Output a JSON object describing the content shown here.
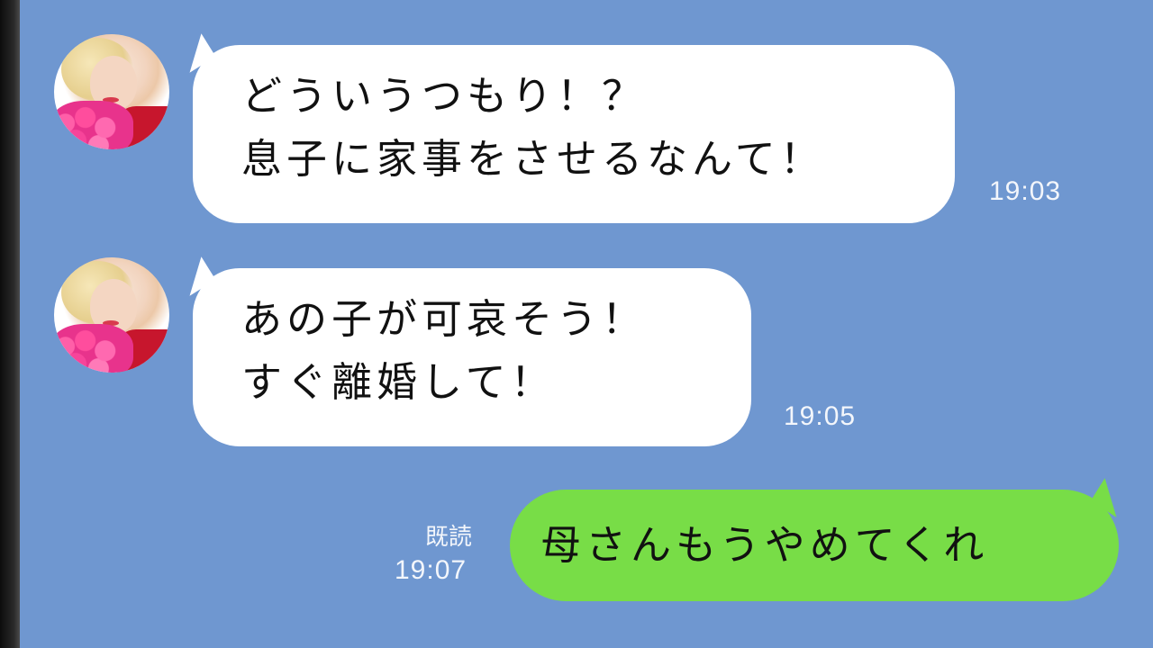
{
  "chat": {
    "messages": [
      {
        "sender": "other",
        "lines": [
          "どういうつもり！？",
          "息子に家事をさせるなんて！"
        ],
        "time": "19:03"
      },
      {
        "sender": "other",
        "lines": [
          "あの子が可哀そう！",
          "すぐ離婚して！"
        ],
        "time": "19:05"
      },
      {
        "sender": "me",
        "text": "母さんもうやめてくれ",
        "read_label": "既読",
        "time": "19:07"
      }
    ]
  },
  "colors": {
    "background": "#6F97D0",
    "incoming_bubble": "#FFFFFF",
    "outgoing_bubble": "#78DD47",
    "timestamp": "#F3F6FB"
  }
}
